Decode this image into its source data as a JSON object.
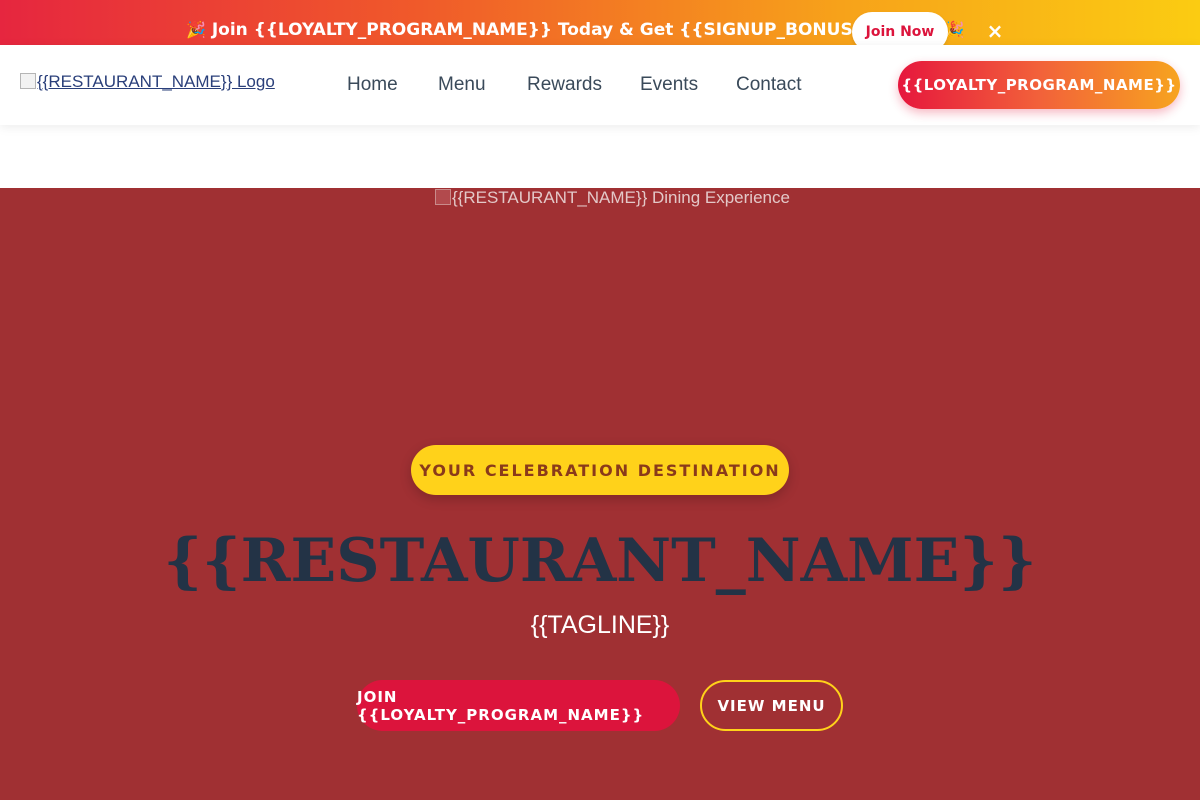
{
  "promo_bar": {
    "emoji_left": "🎉",
    "text": "Join {{LOYALTY_PROGRAM_NAME}} Today & Get {{SIGNUP_BONUS}} FREE!",
    "emoji_right": "🎉",
    "join_label": "Join Now",
    "close_label": "×"
  },
  "header": {
    "logo_alt": "{{RESTAURANT_NAME}} Logo",
    "nav": [
      "Home",
      "Menu",
      "Rewards",
      "Events",
      "Contact"
    ],
    "loyalty_button": "{{LOYALTY_PROGRAM_NAME}}"
  },
  "hero": {
    "image_alt": "{{RESTAURANT_NAME}} Dining Experience",
    "badge": "YOUR CELEBRATION DESTINATION",
    "title": "{{RESTAURANT_NAME}}",
    "tagline": "{{TAGLINE}}",
    "cta_primary": "JOIN {{LOYALTY_PROGRAM_NAME}}",
    "cta_secondary": "VIEW MENU"
  },
  "colors": {
    "brand_red": "#dc143c",
    "hero_bg": "#a03033",
    "accent_yellow": "#ffd21a",
    "title_navy": "#233346"
  }
}
